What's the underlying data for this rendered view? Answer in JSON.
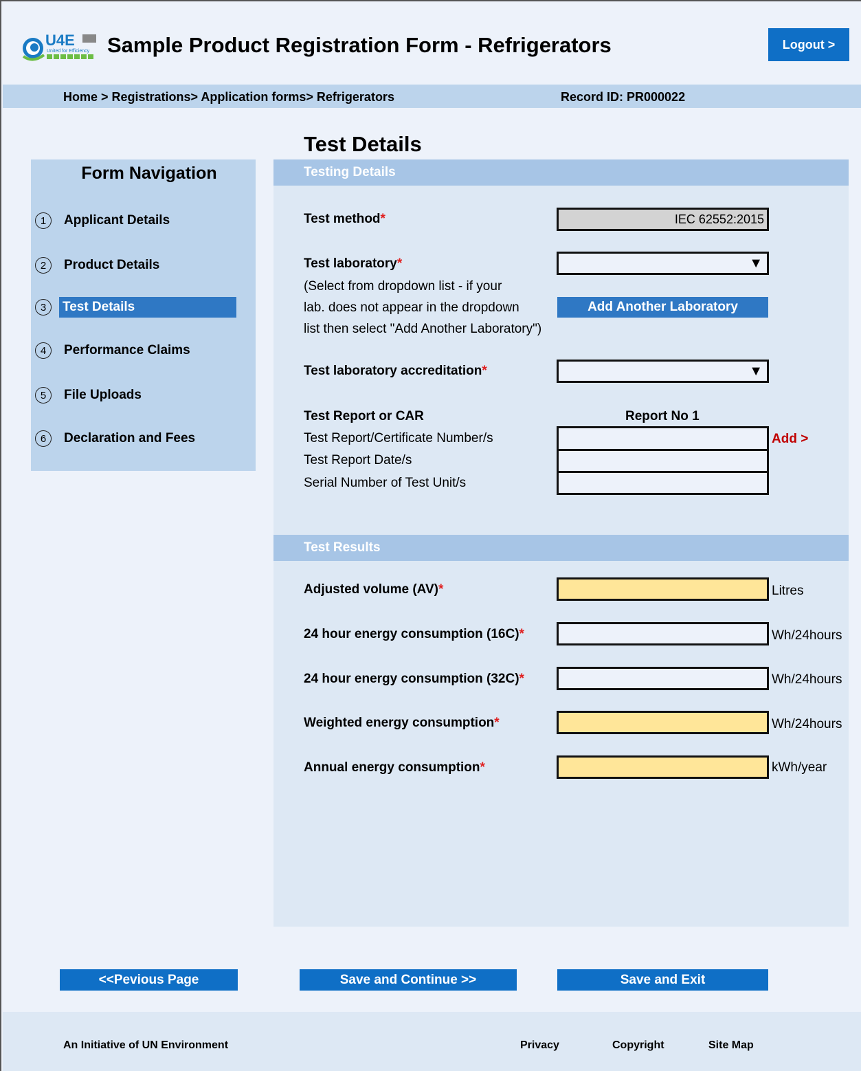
{
  "header": {
    "logo_text": "U4E",
    "logo_subtext": "United for Efficiency",
    "title": "Sample Product Registration Form - Refrigerators",
    "logout_label": "Logout >"
  },
  "breadcrumb": {
    "path": "Home > Registrations> Application forms> Refrigerators",
    "record_id": "Record ID: PR000022"
  },
  "section_title": "Test Details",
  "nav": {
    "title": "Form Navigation",
    "items": [
      {
        "num": "1",
        "label": "Applicant Details"
      },
      {
        "num": "2",
        "label": "Product Details"
      },
      {
        "num": "3",
        "label": "Test Details"
      },
      {
        "num": "4",
        "label": "Performance Claims"
      },
      {
        "num": "5",
        "label": "File Uploads"
      },
      {
        "num": "6",
        "label": "Declaration and Fees"
      }
    ]
  },
  "testing": {
    "heading": "Testing Details",
    "test_method_label": "Test method",
    "test_method_value": "IEC 62552:2015",
    "test_lab_label": "Test laboratory",
    "test_lab_help_1": "(Select from dropdown list - if your",
    "test_lab_help_2": "lab. does not appear in the dropdown",
    "test_lab_help_3": "list then select \"Add Another Laboratory\")",
    "add_lab_label": "Add Another Laboratory",
    "accreditation_label": "Test laboratory accreditation",
    "report_heading": "Test Report or CAR",
    "report_col": "Report No 1",
    "report_number_label": "Test Report/Certificate Number/s",
    "report_date_label": "Test Report Date/s",
    "serial_label": "Serial Number of Test Unit/s",
    "add_label": "Add >",
    "required_mark": "*"
  },
  "results": {
    "heading": "Test Results",
    "rows": [
      {
        "label": "Adjusted volume (AV)",
        "unit": "Litres"
      },
      {
        "label": "24 hour energy consumption (16C)",
        "unit": "Wh/24hours"
      },
      {
        "label": "24 hour energy consumption (32C)",
        "unit": "Wh/24hours"
      },
      {
        "label": "Weighted energy consumption",
        "unit": "Wh/24hours"
      },
      {
        "label": "Annual energy consumption",
        "unit": "kWh/year"
      }
    ]
  },
  "buttons": {
    "previous": "<<Pevious Page",
    "save_continue": "Save and Continue >>",
    "save_exit": "Save and Exit"
  },
  "footer": {
    "initiative": "An Initiative of UN Environment",
    "privacy": "Privacy",
    "copyright": "Copyright",
    "sitemap": "Site Map"
  },
  "colors": {
    "accent": "#0f6fc6",
    "nav_bg": "#bcd4ec",
    "panel_bg": "#dde8f4",
    "calculated_field": "#ffe699",
    "required": "#e02020"
  }
}
